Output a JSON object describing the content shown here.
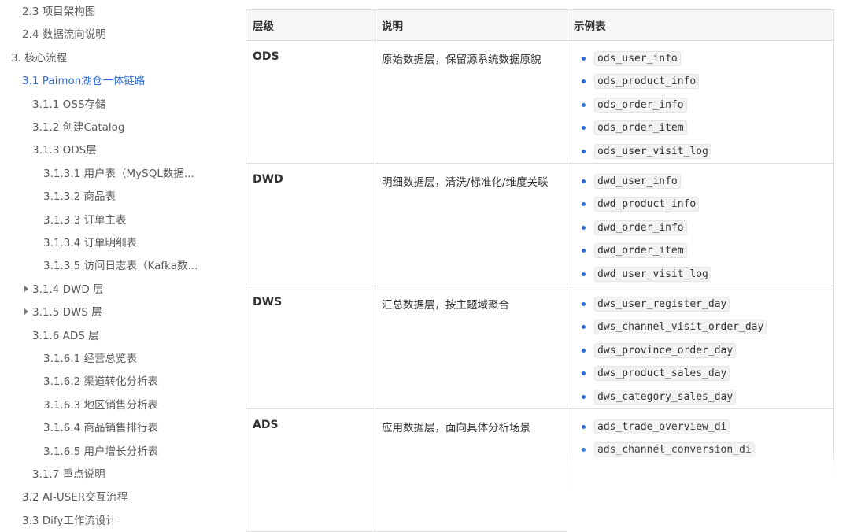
{
  "toc": {
    "items": [
      {
        "label": "2.3 项目架构图",
        "level": 1
      },
      {
        "label": "2.4 数据流向说明",
        "level": 1
      },
      {
        "label": "3. 核心流程",
        "level": 0
      },
      {
        "label": "3.1 Paimon湖仓一体链路",
        "level": 1,
        "active": true
      },
      {
        "label": "3.1.1 OSS存储",
        "level": 2
      },
      {
        "label": "3.1.2 创建Catalog",
        "level": 2
      },
      {
        "label": "3.1.3 ODS层",
        "level": 2
      },
      {
        "label": "3.1.3.1 用户表（MySQL数据...",
        "level": 3
      },
      {
        "label": "3.1.3.2 商品表",
        "level": 3
      },
      {
        "label": "3.1.3.3 订单主表",
        "level": 3
      },
      {
        "label": "3.1.3.4 订单明细表",
        "level": 3
      },
      {
        "label": "3.1.3.5 访问日志表（Kafka数...",
        "level": 3
      },
      {
        "label": "3.1.4 DWD 层",
        "level": 2,
        "collapsed": true
      },
      {
        "label": "3.1.5 DWS 层",
        "level": 2,
        "collapsed": true
      },
      {
        "label": "3.1.6 ADS 层",
        "level": 2
      },
      {
        "label": "3.1.6.1 经营总览表",
        "level": 3
      },
      {
        "label": "3.1.6.2 渠道转化分析表",
        "level": 3
      },
      {
        "label": "3.1.6.3 地区销售分析表",
        "level": 3
      },
      {
        "label": "3.1.6.4 商品销售排行表",
        "level": 3
      },
      {
        "label": "3.1.6.5 用户增长分析表",
        "level": 3
      },
      {
        "label": "3.1.7 重点说明",
        "level": 2
      },
      {
        "label": "3.2 AI-USER交互流程",
        "level": 1
      },
      {
        "label": "3.3 Dify工作流设计",
        "level": 1
      }
    ]
  },
  "table": {
    "headers": [
      "层级",
      "说明",
      "示例表"
    ],
    "rows": [
      {
        "layer": "ODS",
        "desc": "原始数据层，保留源系统数据原貌",
        "tables": [
          "ods_user_info",
          "ods_product_info",
          "ods_order_info",
          "ods_order_item",
          "ods_user_visit_log"
        ]
      },
      {
        "layer": "DWD",
        "desc": "明细数据层，清洗/标准化/维度关联",
        "tables": [
          "dwd_user_info",
          "dwd_product_info",
          "dwd_order_info",
          "dwd_order_item",
          "dwd_user_visit_log"
        ]
      },
      {
        "layer": "DWS",
        "desc": "汇总数据层，按主题域聚合",
        "tables": [
          "dws_user_register_day",
          "dws_channel_visit_order_day",
          "dws_province_order_day",
          "dws_product_sales_day",
          "dws_category_sales_day"
        ]
      },
      {
        "layer": "ADS",
        "desc": "应用数据层，面向具体分析场景",
        "tables": [
          "ads_trade_overview_di",
          "ads_channel_conversion_di"
        ]
      }
    ]
  },
  "colors": {
    "accent": "#2f6fd8",
    "border": "#dcdcdc",
    "header_bg": "#f6f6f6"
  }
}
